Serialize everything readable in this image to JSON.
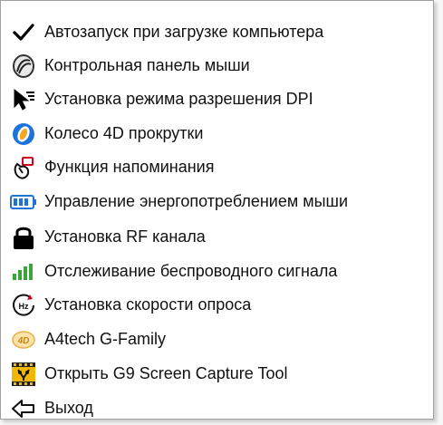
{
  "menu": {
    "items": [
      {
        "label": "Автозапуск при загрузке компьютера",
        "icon": "checkmark-icon",
        "checked": true
      },
      {
        "label": "Контрольная панель мыши",
        "icon": "mouse-panel-icon"
      },
      {
        "label": "Установка режима разрешения DPI",
        "icon": "dpi-cursor-icon"
      },
      {
        "label": "Колесо 4D прокрутки",
        "icon": "scroll-wheel-icon"
      },
      {
        "label": "Функция напоминания",
        "icon": "reminder-icon"
      },
      {
        "label": "Управление энергопотреблением мыши",
        "icon": "battery-icon"
      },
      {
        "label": "Установка RF канала",
        "icon": "lock-icon"
      },
      {
        "label": "Отслеживание беспроводного сигнала",
        "icon": "signal-bars-icon"
      },
      {
        "label": "Установка скорости опроса",
        "icon": "polling-rate-icon"
      },
      {
        "label": "A4tech G-Family",
        "icon": "g-family-logo-icon"
      },
      {
        "label": "Открыть G9 Screen Capture Tool",
        "icon": "screen-capture-icon"
      },
      {
        "label": "Выход",
        "icon": "exit-arrow-icon"
      }
    ]
  },
  "icon_text": {
    "polling": "Hz",
    "gfamily": "4D"
  },
  "colors": {
    "blue": "#1e73d8",
    "orange": "#f5a623",
    "red": "#d0021b",
    "green": "#3aa63a",
    "yellow": "#f2b705"
  }
}
